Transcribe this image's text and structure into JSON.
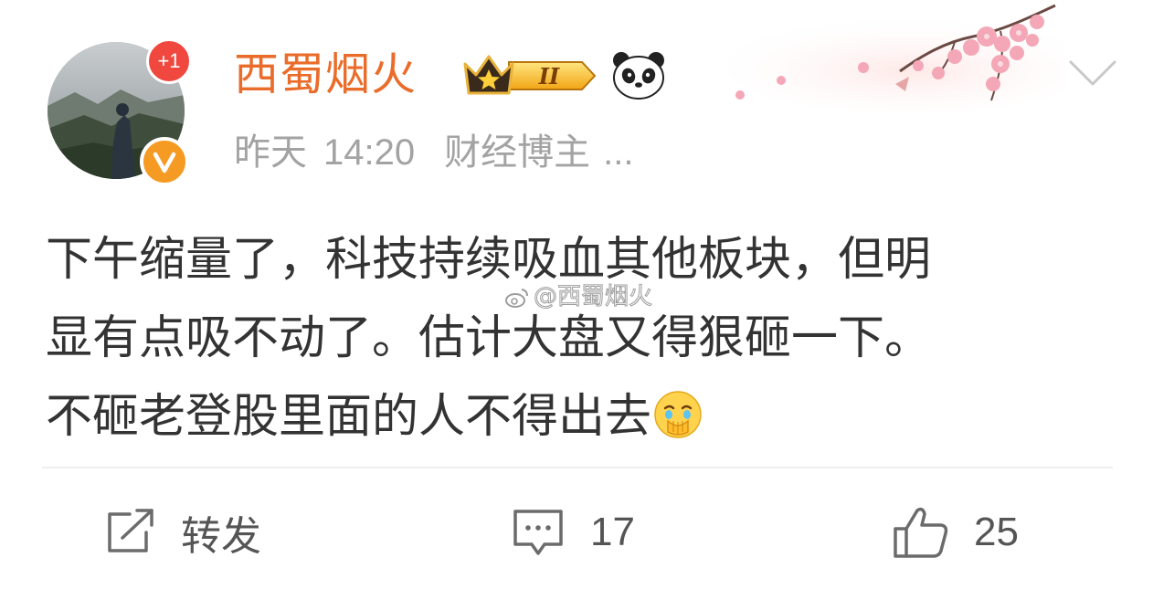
{
  "post": {
    "author": {
      "name": "西蜀烟火",
      "notification_badge": "+1",
      "verified_icon": "verified-v-icon",
      "vip_level": "II",
      "accent_color": "#ea6c2a"
    },
    "time_label": "昨天",
    "time": "14:20",
    "source": "财经博主",
    "source_more": "...",
    "content_lines": [
      "下午缩量了，科技持续吸血其他板块，但明",
      "显有点吸不动了。估计大盘又得狠砸一下。",
      "不砸老登股里面的人不得出去"
    ],
    "emoji_icon": "crying-face-emoji",
    "watermark": "@西蜀烟火"
  },
  "actions": {
    "repost_label": "转发",
    "comment_count": "17",
    "like_count": "25"
  },
  "colors": {
    "text": "#333333",
    "meta": "#a3a3a3",
    "badge_red": "#f0483e",
    "verified_orange": "#f59a23"
  }
}
